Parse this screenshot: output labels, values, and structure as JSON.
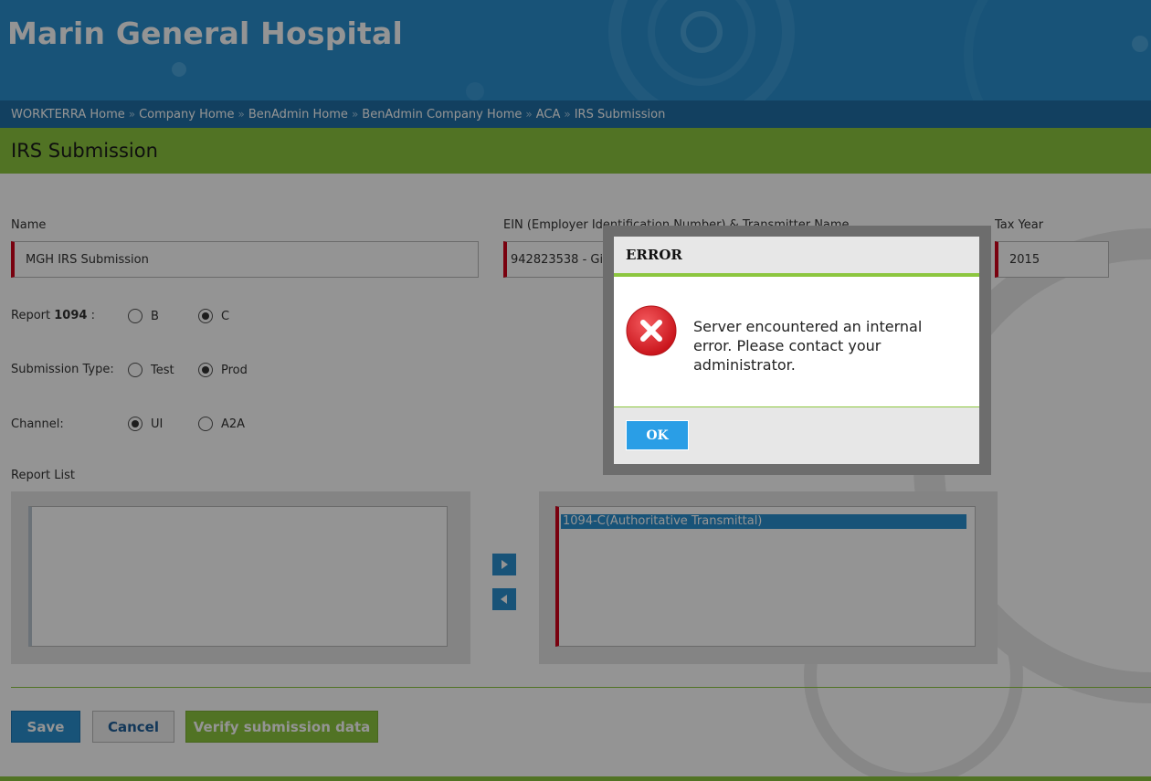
{
  "header": {
    "title": "Marin General Hospital"
  },
  "breadcrumb": [
    "WORKTERRA Home",
    "Company Home",
    "BenAdmin Home",
    "BenAdmin Company Home",
    "ACA",
    "IRS Submission"
  ],
  "breadcrumb_separator": "»",
  "page": {
    "title": "IRS Submission"
  },
  "form": {
    "name_label": "Name",
    "name_value": "MGH IRS Submission",
    "ein_label": "EIN (Employer Identification Number) & Transmitter Name",
    "ein_value": "942823538 - Ginge",
    "tax_year_label": "Tax Year",
    "tax_year_value": "2015",
    "report_label": "Report",
    "report_number": "1094",
    "report_colon": ":",
    "report_options": [
      "B",
      "C"
    ],
    "report_selected": "C",
    "submission_type_label": "Submission Type:",
    "submission_type_options": [
      "Test",
      "Prod"
    ],
    "submission_type_selected": "Prod",
    "channel_label": "Channel:",
    "channel_options": [
      "UI",
      "A2A"
    ],
    "channel_selected": "UI",
    "report_list_label": "Report List",
    "available_reports": [],
    "selected_reports": [
      "1094-C(Authoritative Transmittal)"
    ]
  },
  "buttons": {
    "save": "Save",
    "cancel": "Cancel",
    "verify": "Verify submission data"
  },
  "dialog": {
    "title": "ERROR",
    "message": "Server encountered an internal error. Please contact your administrator.",
    "ok": "OK",
    "icon": "error-x-icon"
  },
  "colors": {
    "brand_blue": "#2a8fcf",
    "breadcrumb_blue": "#1f6fa5",
    "accent_green": "#8cc63f",
    "required_red": "#d0021b",
    "error_red": "#e0252b"
  }
}
